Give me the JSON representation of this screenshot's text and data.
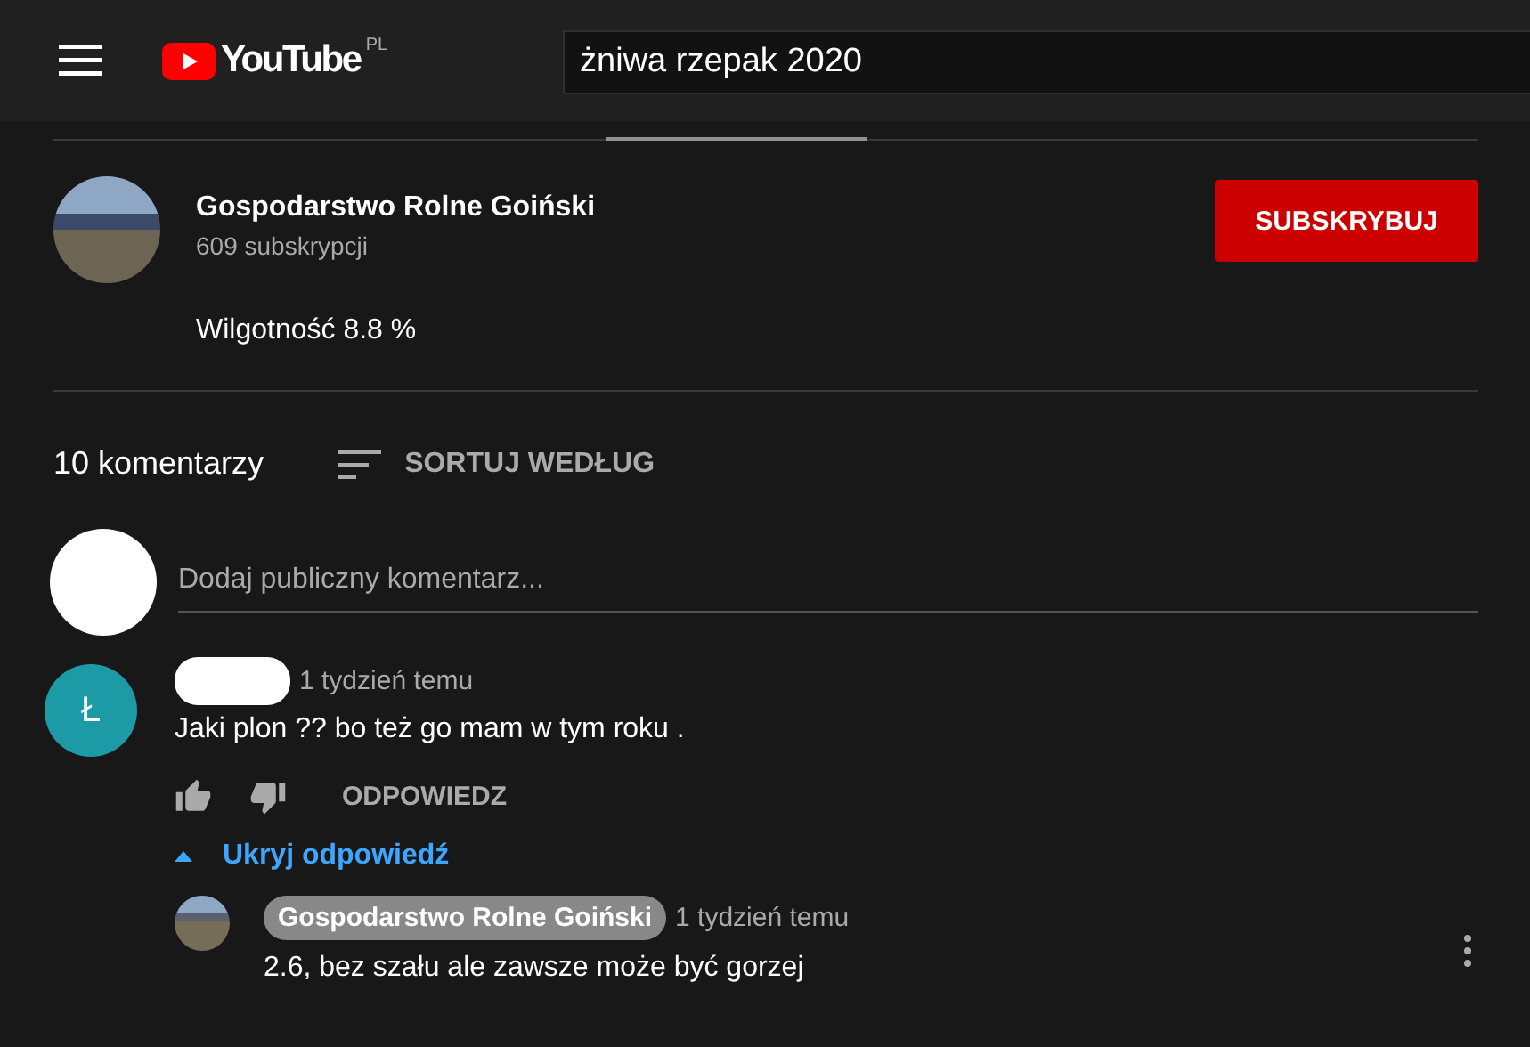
{
  "header": {
    "logo_text": "YouTube",
    "region": "PL",
    "search": {
      "value": "żniwa rzepak 2020"
    }
  },
  "channel": {
    "name": "Gospodarstwo Rolne Goiński",
    "subscribers": "609 subskrypcji",
    "subscribe_button": "SUBSKRYBUJ",
    "description": "Wilgotność 8.8 %"
  },
  "comments_header": {
    "count": "10 komentarzy",
    "sort_label": "SORTUJ WEDŁUG"
  },
  "add_comment": {
    "placeholder": "Dodaj publiczny komentarz..."
  },
  "comments": [
    {
      "avatar_letter": "Ł",
      "color": "#1c9aa6",
      "author_redacted": true,
      "time": "1 tydzień temu",
      "text": "Jaki plon ??  bo też go mam w tym roku .",
      "reply_button": "ODPOWIEDZ",
      "replies_toggle": {
        "label": "Ukryj odpowiedź",
        "expanded": true
      },
      "replies": [
        {
          "author": "Gospodarstwo Rolne Goiński",
          "author_is_owner": true,
          "time": "1 tydzień temu",
          "text": "2.6, bez szału ale zawsze może być gorzej"
        }
      ]
    }
  ]
}
